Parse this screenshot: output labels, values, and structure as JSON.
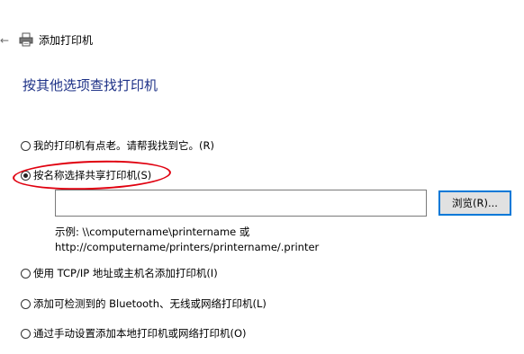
{
  "window": {
    "back_icon": "back-arrow-icon",
    "printer_icon": "printer-icon",
    "title": "添加打印机"
  },
  "heading": "按其他选项查找打印机",
  "options": [
    {
      "label": "我的打印机有点老。请帮我找到它。(R)",
      "checked": false
    },
    {
      "label": "按名称选择共享打印机(S)",
      "checked": true
    },
    {
      "label": "使用 TCP/IP 地址或主机名添加打印机(I)",
      "checked": false
    },
    {
      "label": "添加可检测到的 Bluetooth、无线或网络打印机(L)",
      "checked": false
    },
    {
      "label": "通过手动设置添加本地打印机或网络打印机(O)",
      "checked": false
    }
  ],
  "shared_printer": {
    "input_value": "",
    "browse_label": "浏览(R)...",
    "example_line1": "示例: \\\\computername\\printername 或",
    "example_line2": "http://computername/printers/printername/.printer"
  },
  "colors": {
    "heading": "#1e3287",
    "highlight": "#e0000f",
    "button_focus_border": "#0078d7"
  }
}
